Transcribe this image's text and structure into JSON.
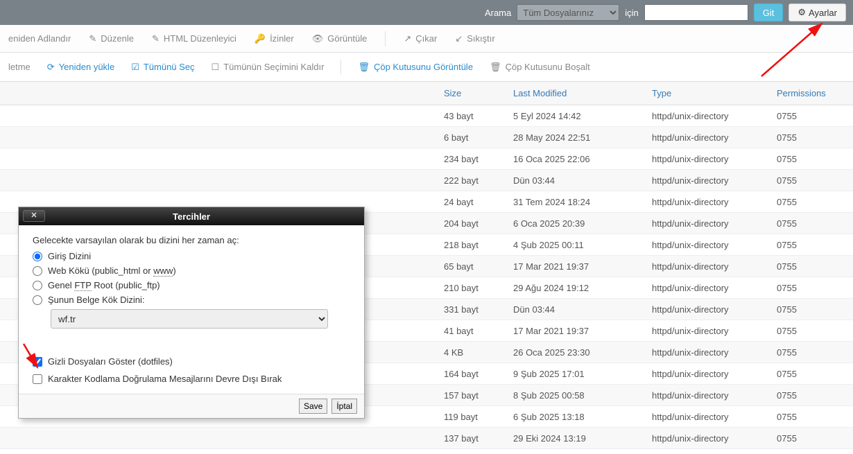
{
  "topbar": {
    "search_label": "Arama",
    "select_value": "Tüm Dosyalarınız",
    "for_label": "için",
    "go_btn": "Git",
    "settings_btn": "Ayarlar"
  },
  "toolbar1": {
    "rename": "eniden Adlandır",
    "edit": "Düzenle",
    "html_editor": "HTML Düzenleyici",
    "permissions": "İzinler",
    "view": "Görüntüle",
    "extract": "Çıkar",
    "compress": "Sıkıştır"
  },
  "toolbar2": {
    "forward": "letme",
    "reload": "Yeniden yükle",
    "select_all": "Tümünü Seç",
    "deselect_all": "Tümünün Seçimini Kaldır",
    "view_trash": "Çöp Kutusunu Görüntüle",
    "empty_trash": "Çöp Kutusunu Boşalt"
  },
  "table": {
    "headers": {
      "size": "Size",
      "modified": "Last Modified",
      "type": "Type",
      "permissions": "Permissions"
    },
    "rows": [
      {
        "size": "43 bayt",
        "modified": "5 Eyl 2024 14:42",
        "type": "httpd/unix-directory",
        "perm": "0755"
      },
      {
        "size": "6 bayt",
        "modified": "28 May 2024 22:51",
        "type": "httpd/unix-directory",
        "perm": "0755"
      },
      {
        "size": "234 bayt",
        "modified": "16 Oca 2025 22:06",
        "type": "httpd/unix-directory",
        "perm": "0755"
      },
      {
        "size": "222 bayt",
        "modified": "Dün 03:44",
        "type": "httpd/unix-directory",
        "perm": "0755"
      },
      {
        "size": "24 bayt",
        "modified": "31 Tem 2024 18:24",
        "type": "httpd/unix-directory",
        "perm": "0755"
      },
      {
        "size": "204 bayt",
        "modified": "6 Oca 2025 20:39",
        "type": "httpd/unix-directory",
        "perm": "0755"
      },
      {
        "size": "218 bayt",
        "modified": "4 Şub 2025 00:11",
        "type": "httpd/unix-directory",
        "perm": "0755"
      },
      {
        "size": "65 bayt",
        "modified": "17 Mar 2021 19:37",
        "type": "httpd/unix-directory",
        "perm": "0755"
      },
      {
        "size": "210 bayt",
        "modified": "29 Ağu 2024 19:12",
        "type": "httpd/unix-directory",
        "perm": "0755"
      },
      {
        "size": "331 bayt",
        "modified": "Dün 03:44",
        "type": "httpd/unix-directory",
        "perm": "0755"
      },
      {
        "size": "41 bayt",
        "modified": "17 Mar 2021 19:37",
        "type": "httpd/unix-directory",
        "perm": "0755"
      },
      {
        "size": "4 KB",
        "modified": "26 Oca 2025 23:30",
        "type": "httpd/unix-directory",
        "perm": "0755"
      },
      {
        "size": "164 bayt",
        "modified": "9 Şub 2025 17:01",
        "type": "httpd/unix-directory",
        "perm": "0755"
      },
      {
        "size": "157 bayt",
        "modified": "8 Şub 2025 00:58",
        "type": "httpd/unix-directory",
        "perm": "0755"
      },
      {
        "size": "119 bayt",
        "modified": "6 Şub 2025 13:18",
        "type": "httpd/unix-directory",
        "perm": "0755"
      },
      {
        "size": "137 bayt",
        "modified": "29 Eki 2024 13:19",
        "type": "httpd/unix-directory",
        "perm": "0755"
      }
    ]
  },
  "dialog": {
    "title": "Tercihler",
    "desc": "Gelecekte varsayılan olarak bu dizini her zaman aç:",
    "opt_home": "Giriş Dizini",
    "opt_webroot_pre": "Web Kökü (public_html or ",
    "opt_webroot_dotted": "www",
    "opt_webroot_post": ")",
    "opt_ftp_pre": "Genel ",
    "opt_ftp_dotted": "FTP",
    "opt_ftp_post": " Root (public_ftp)",
    "opt_docroot": "Şunun Belge Kök Dizini:",
    "docroot_value": "wf.tr",
    "chk_dotfiles": "Gizli Dosyaları Göster (dotfiles)",
    "chk_charset": "Karakter Kodlama Doğrulama Mesajlarını Devre Dışı Bırak",
    "btn_save": "Save",
    "btn_cancel": "İptal"
  }
}
